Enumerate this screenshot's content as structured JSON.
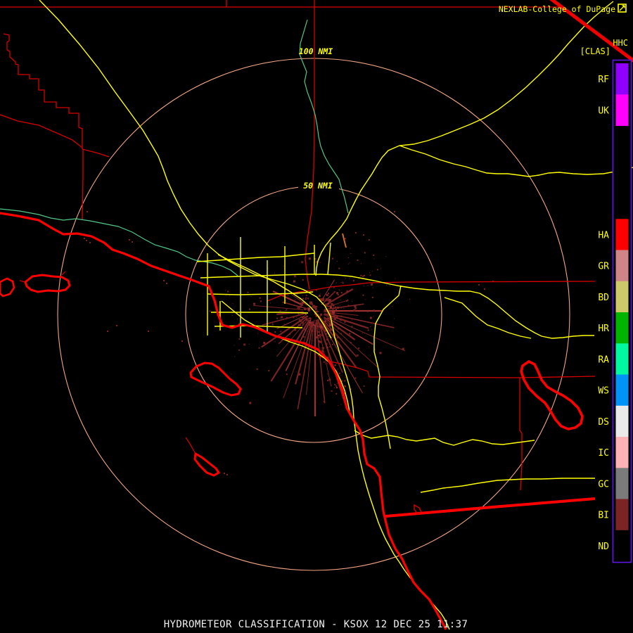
{
  "header": {
    "brand": "NEXLAB-College of DuPage",
    "logo_icon": "nexlab-logo-icon",
    "product_code": "HHC",
    "product_tag": "[CLAS]"
  },
  "range_rings": {
    "outer_label": "100 NMI",
    "inner_label": "50 NMI"
  },
  "status_bar": {
    "text": "HYDROMETEOR CLASSIFICATION - KSOX 12 DEC 25 11:37",
    "product": "HYDROMETEOR CLASSIFICATION",
    "station": "KSOX",
    "datetime": "12 DEC 25 11:37"
  },
  "legend": {
    "title": "HHC",
    "categories": [
      {
        "label": "RF",
        "color": "#9000ff"
      },
      {
        "label": "UK",
        "color": "#ff00ff"
      },
      {
        "label": "HA",
        "color": "#ff0000"
      },
      {
        "label": "GR",
        "color": "#cf8487"
      },
      {
        "label": "BD",
        "color": "#cdc968"
      },
      {
        "label": "HR",
        "color": "#00b400"
      },
      {
        "label": "RA",
        "color": "#00f8a0"
      },
      {
        "label": "WS",
        "color": "#0094f8"
      },
      {
        "label": "DS",
        "color": "#eaeaea"
      },
      {
        "label": "IC",
        "color": "#ffb2b6"
      },
      {
        "label": "GC",
        "color": "#7b7b7b"
      },
      {
        "label": "BI",
        "color": "#7c2424"
      },
      {
        "label": "ND",
        "color": "#000000"
      }
    ],
    "border_color": "#6018e8"
  },
  "map_colors": {
    "background": "#000000",
    "range_ring": "#f0a482",
    "county_line": "#d80000",
    "coastline": "#ff0000",
    "highway": "#ffff00",
    "river": "#50c888",
    "echo_base": "#7c2222",
    "echo_bright": "#9a3030",
    "echo_dim": "#641c1c",
    "echo_accent": "#c87028"
  }
}
